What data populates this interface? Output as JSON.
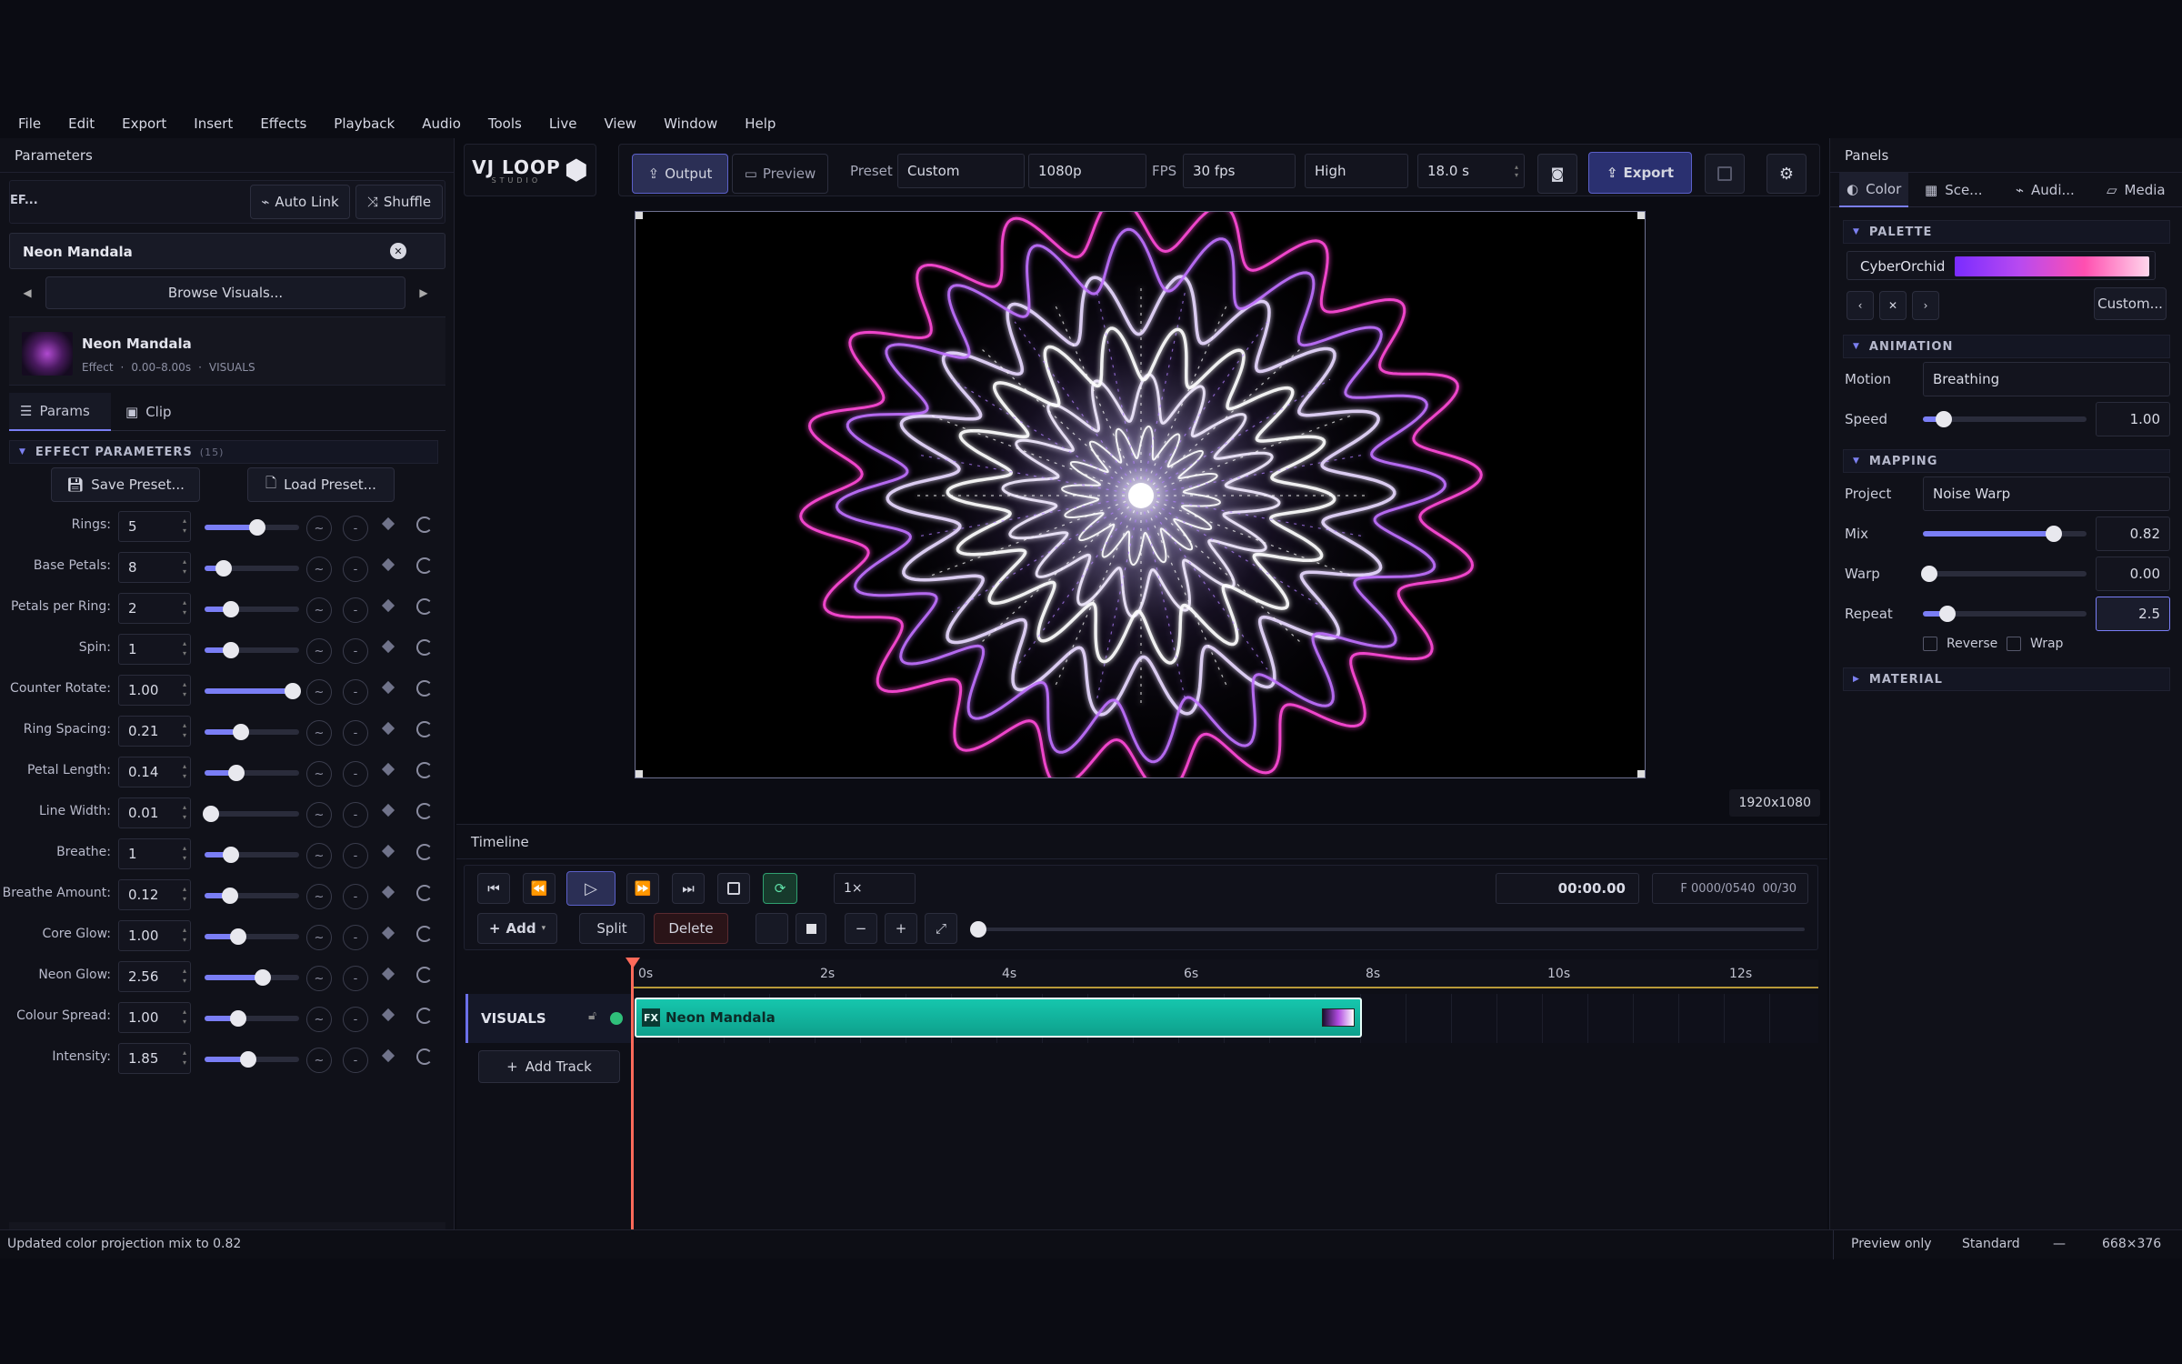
{
  "menu": [
    "File",
    "Edit",
    "Export",
    "Insert",
    "Effects",
    "Playback",
    "Audio",
    "Tools",
    "Live",
    "View",
    "Window",
    "Help"
  ],
  "left": {
    "title": "Parameters",
    "effect_abbrev": "EF...",
    "auto_link": "Auto Link",
    "shuffle": "Shuffle",
    "selected_name": "Neon Mandala",
    "browse": "Browse Visuals...",
    "clip_name": "Neon Mandala",
    "clip_meta_type": "Effect",
    "clip_meta_range": "0.00–8.00s",
    "clip_meta_track": "VISUALS",
    "tab_params": "Params",
    "tab_clip": "Clip",
    "section_title": "EFFECT PARAMETERS",
    "section_count": "(15)",
    "save_preset": "Save Preset...",
    "load_preset": "Load Preset...",
    "params": [
      {
        "label": "Rings:",
        "value": "5",
        "frac": 0.56
      },
      {
        "label": "Base Petals:",
        "value": "8",
        "frac": 0.2
      },
      {
        "label": "Petals per Ring:",
        "value": "2",
        "frac": 0.28
      },
      {
        "label": "Spin:",
        "value": "1",
        "frac": 0.28
      },
      {
        "label": "Counter Rotate:",
        "value": "1.00",
        "frac": 0.93
      },
      {
        "label": "Ring Spacing:",
        "value": "0.21",
        "frac": 0.38
      },
      {
        "label": "Petal Length:",
        "value": "0.14",
        "frac": 0.34
      },
      {
        "label": "Line Width:",
        "value": "0.01",
        "frac": 0.07
      },
      {
        "label": "Breathe:",
        "value": "1",
        "frac": 0.28
      },
      {
        "label": "Breathe Amount:",
        "value": "0.12",
        "frac": 0.27
      },
      {
        "label": "Core Glow:",
        "value": "1.00",
        "frac": 0.36
      },
      {
        "label": "Neon Glow:",
        "value": "2.56",
        "frac": 0.62
      },
      {
        "label": "Colour Spread:",
        "value": "1.00",
        "frac": 0.36
      },
      {
        "label": "Intensity:",
        "value": "1.85",
        "frac": 0.46
      }
    ]
  },
  "toolbar": {
    "logo": "VJ LOOP",
    "logo_sub": "STUDIO",
    "output": "Output",
    "preview": "Preview",
    "preset_label": "Preset",
    "preset_value": "Custom",
    "resolution": "1080p",
    "fps_label": "FPS",
    "fps_value": "30 fps",
    "quality": "High",
    "duration": "18.0 s",
    "export": "Export"
  },
  "canvas": {
    "resolution_badge": "1920x1080"
  },
  "timeline": {
    "title": "Timeline",
    "speed": "1×",
    "timecode": "00:00.00",
    "frame": "F 0000/0540",
    "frame_fps": "00/30",
    "add": "Add",
    "split": "Split",
    "delete": "Delete",
    "ruler": [
      "0s",
      "2s",
      "4s",
      "6s",
      "8s",
      "10s",
      "12s"
    ],
    "track_name": "VISUALS",
    "clip_label": "Neon Mandala",
    "clip_badge": "FX",
    "add_track": "Add Track"
  },
  "right": {
    "title": "Panels",
    "tabs": [
      "Color",
      "Sce...",
      "Audi...",
      "Media"
    ],
    "palette_section": "PALETTE",
    "palette_name": "CyberOrchid",
    "palette_custom": "Custom...",
    "animation_section": "ANIMATION",
    "motion_label": "Motion",
    "motion_value": "Breathing",
    "speed_label": "Speed",
    "speed_value": "1.00",
    "speed_frac": 0.13,
    "mapping_section": "MAPPING",
    "project_label": "Project",
    "project_value": "Noise Warp",
    "mix_label": "Mix",
    "mix_value": "0.82",
    "mix_frac": 0.8,
    "warp_label": "Warp",
    "warp_value": "0.00",
    "warp_frac": 0.04,
    "repeat_label": "Repeat",
    "repeat_value": "2.5",
    "repeat_frac": 0.15,
    "reverse": "Reverse",
    "wrap": "Wrap",
    "material_section": "MATERIAL"
  },
  "status": {
    "message": "Updated color projection mix to 0.82",
    "mode": "Preview only",
    "quality": "Standard",
    "dash": "—",
    "size": "668×376"
  },
  "colors": {
    "accent": "#7a7ef5",
    "clip": "#12b8a0",
    "export": "#2a3070",
    "playhead": "#ff6a5a"
  }
}
